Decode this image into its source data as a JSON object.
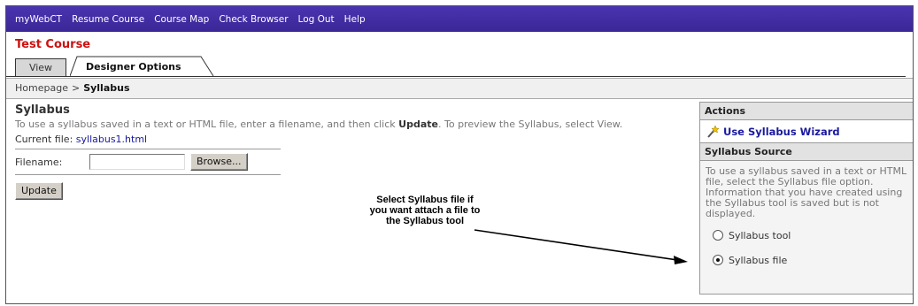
{
  "topnav": {
    "items": [
      "myWebCT",
      "Resume Course",
      "Course Map",
      "Check Browser",
      "Log Out",
      "Help"
    ],
    "bg_color": "#3f2aa0"
  },
  "course": {
    "title": "Test Course",
    "title_color": "#cc1111"
  },
  "tabs": {
    "view": "View",
    "designer": "Designer Options"
  },
  "breadcrumb": {
    "home": "Homepage",
    "separator": ">",
    "current": "Syllabus"
  },
  "main": {
    "title": "Syllabus",
    "instr_before": "To use a syllabus saved in a text or HTML file, enter a filename, and then click ",
    "instr_bold": "Update",
    "instr_after": ". To preview the Syllabus, select View.",
    "current_file_label": "Current file:",
    "current_file_value": "syllabus1.html",
    "filename_label": "Filename:",
    "filename_value": "",
    "browse_label": "Browse...",
    "update_label": "Update"
  },
  "annotation": {
    "line1": "Select Syllabus file if",
    "line2": "you want attach a file to",
    "line3": "the Syllabus tool"
  },
  "sidebar": {
    "actions_header": "Actions",
    "wizard_label": "Use Syllabus Wizard",
    "wizard_icon": "magic-wand-icon",
    "source_header": "Syllabus Source",
    "source_text": "To use a syllabus saved in a text or HTML file, select the Syllabus file option. Information that you have created using the Syllabus tool is saved but is not displayed.",
    "option_tool": "Syllabus tool",
    "option_file": "Syllabus file",
    "selected": "Syllabus file"
  }
}
